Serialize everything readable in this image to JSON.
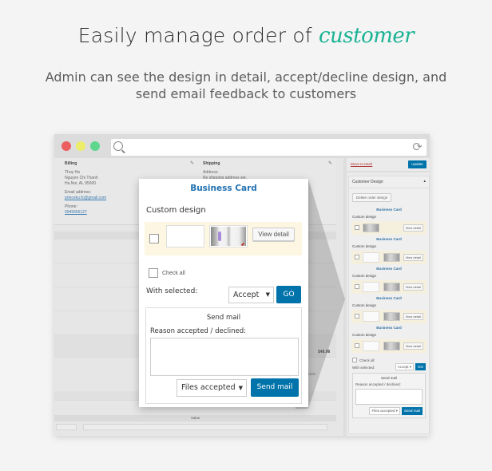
{
  "headline": {
    "prefix": "Easily manage order of",
    "accent": "customer",
    "accent_color": "#1ab394"
  },
  "subhead": {
    "line1": "Admin can see the design in detail, accept/decline design, and",
    "line2": "send email feedback to customers"
  },
  "browser": {
    "controls": [
      "close",
      "minimize",
      "maximize"
    ],
    "search_icon": "search-icon",
    "reload_icon": "reload-icon",
    "reload_glyph": "⟳"
  },
  "order": {
    "billing": {
      "heading": "Billing",
      "name": "Thuy Ha",
      "street": "Nguyen Chi Thanh",
      "city": "Ha Noi, AL 95000",
      "email_label": "Email address:",
      "email": "princeku.fc@gmail.com",
      "phone_label": "Phone:",
      "phone": "0945665127"
    },
    "shipping": {
      "heading": "Shipping",
      "address_label": "Address:",
      "address": "No shipping address set."
    },
    "total": "$48.96",
    "note": "...ger editable.",
    "value_header": "Value"
  },
  "sidebar": {
    "trash_link": "Move to trash",
    "update_button": "Update",
    "box_title": "Customer Design",
    "delete_button": "Delete order design",
    "groups": [
      {
        "title": "Business Card",
        "label": "Custom design",
        "view": "View detail"
      },
      {
        "title": "Business Card",
        "label": "Custom design",
        "view": "View detail"
      },
      {
        "title": "Business Card",
        "label": "Custom design",
        "view": "View detail"
      },
      {
        "title": "Business Card",
        "label": "Custom design",
        "view": "View detail"
      },
      {
        "title": "Business Card",
        "label": "Custom design",
        "view": "View detail"
      }
    ],
    "check_all": "Check all",
    "with_selected": "With selected:",
    "action_value": "Accept",
    "go": "GO",
    "send_mail_title": "Send mail",
    "reason_label": "Reason accepted / declined:",
    "files_value": "Files accepted",
    "send_button": "Send mail"
  },
  "popup": {
    "title": "Business Card",
    "section": "Custom design",
    "view_detail": "View detail",
    "check_all": "Check all",
    "with_selected": "With selected:",
    "action_value": "Accept",
    "go": "GO",
    "send_mail_title": "Send mail",
    "reason_label": "Reason accepted / declined:",
    "reason_value": "",
    "files_value": "Files accepted",
    "send_button": "Send mail",
    "dropdown_arrow": "▼"
  }
}
